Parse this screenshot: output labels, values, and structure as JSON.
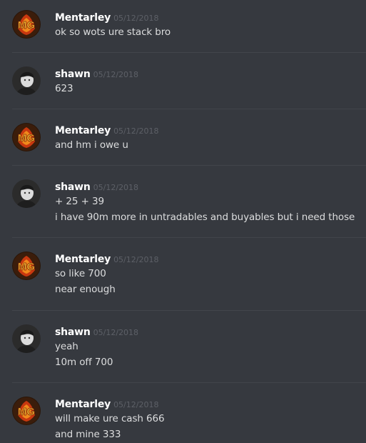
{
  "messages": [
    {
      "author": "Mentarley",
      "avatar": "mg-logo-avatar",
      "timestamp": "05/12/2018",
      "lines": [
        "ok so wots ure stack bro"
      ]
    },
    {
      "author": "shawn",
      "avatar": "user-photo-avatar",
      "timestamp": "05/12/2018",
      "lines": [
        "623"
      ]
    },
    {
      "author": "Mentarley",
      "avatar": "mg-logo-avatar",
      "timestamp": "05/12/2018",
      "lines": [
        "and hm i owe u"
      ]
    },
    {
      "author": "shawn",
      "avatar": "user-photo-avatar",
      "timestamp": "05/12/2018",
      "lines": [
        "+ 25 + 39",
        "i have 90m more in untradables and buyables but i need those"
      ]
    },
    {
      "author": "Mentarley",
      "avatar": "mg-logo-avatar",
      "timestamp": "05/12/2018",
      "lines": [
        "so like 700",
        "near enough"
      ]
    },
    {
      "author": "shawn",
      "avatar": "user-photo-avatar",
      "timestamp": "05/12/2018",
      "lines": [
        "yeah",
        "10m off 700"
      ]
    },
    {
      "author": "Mentarley",
      "avatar": "mg-logo-avatar",
      "timestamp": "05/12/2018",
      "lines": [
        "will make ure cash 666",
        "and mine 333"
      ]
    }
  ],
  "colors": {
    "background": "#36393f",
    "username": "#ffffff",
    "timestamp": "#5d6067",
    "message_text": "#dcddde",
    "divider": "#42454b"
  }
}
